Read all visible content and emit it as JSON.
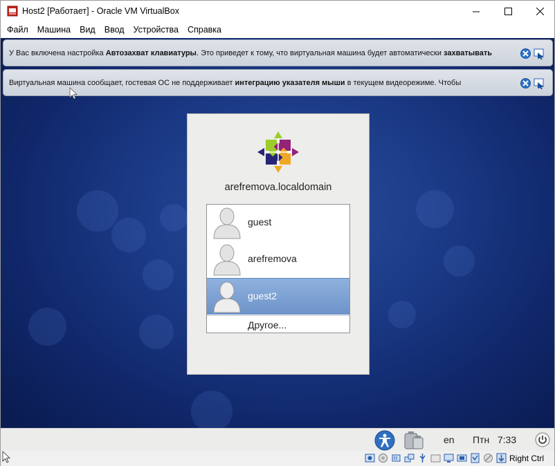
{
  "window": {
    "title": "Host2 [Работает] - Oracle VM VirtualBox"
  },
  "menu": [
    "Файл",
    "Машина",
    "Вид",
    "Ввод",
    "Устройства",
    "Справка"
  ],
  "banners": {
    "keyboard": {
      "prefix": "У Вас включена настройка ",
      "bold1": "Автозахват клавиатуры",
      "middle": ". Это приведет к тому, что виртуальная машина будет автоматически ",
      "bold2": "захватывать"
    },
    "mouse": {
      "prefix": "Виртуальная машина сообщает, гостевая ОС не поддерживает ",
      "bold": "интеграцию указателя мыши",
      "suffix": " в текущем видеорежиме. Чтобы"
    }
  },
  "login": {
    "hostname": "arefremova.localdomain",
    "users": [
      {
        "name": "guest",
        "selected": false
      },
      {
        "name": "arefremova",
        "selected": false
      },
      {
        "name": "guest2",
        "selected": true
      }
    ],
    "other": "Другое..."
  },
  "guest_panel": {
    "language": "en",
    "clock": "Птн   7:33"
  },
  "host_status": {
    "host_key": "Right Ctrl"
  },
  "colors": {
    "selection": "#7d9fd3",
    "banner": "#d7dce4",
    "desktop": "#1b3a86"
  }
}
